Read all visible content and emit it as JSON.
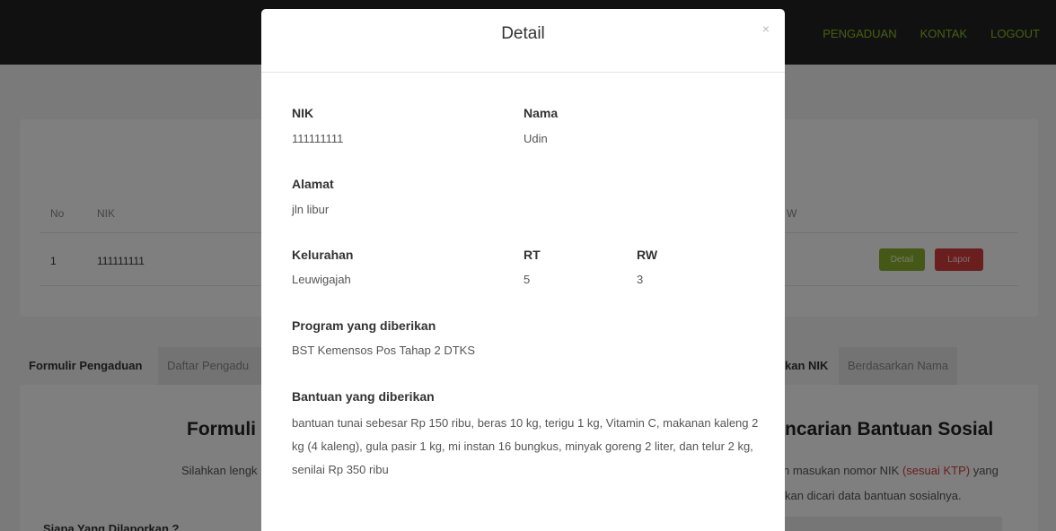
{
  "nav": {
    "links": [
      "PENGADUAN",
      "KONTAK",
      "LOGOUT"
    ]
  },
  "table": {
    "headers": {
      "no": "No",
      "nik": "NIK",
      "rw": "W"
    },
    "rows": [
      {
        "no": "1",
        "nik": "111111111"
      }
    ],
    "detail_label": "Detail",
    "lapor_label": "Lapor"
  },
  "tabs": {
    "left": [
      "Formulir Pengaduan",
      "Daftar Pengadu"
    ],
    "right": [
      "kan NIK",
      "Berdasarkan Nama"
    ]
  },
  "forms": {
    "left_title": "Formuli",
    "left_subtitle": "Silahkan lengk",
    "left_question": "Siapa Yang Dilaporkan ?",
    "right_title": "ncarian Bantuan Sosial",
    "right_line1_pre": "n masukan nomor NIK ",
    "right_line1_red": "(sesuai KTP)",
    "right_line1_post": " yang",
    "right_line2": "kan dicari data bantuan sosialnya."
  },
  "modal": {
    "title": "Detail",
    "close_symbol": "×",
    "nik_label": "NIK",
    "nik_value": "111111111",
    "nama_label": "Nama",
    "nama_value": "Udin",
    "alamat_label": "Alamat",
    "alamat_value": "jln libur",
    "kelurahan_label": "Kelurahan",
    "kelurahan_value": "Leuwigajah",
    "rt_label": "RT",
    "rt_value": "5",
    "rw_label": "RW",
    "rw_value": "3",
    "program_label": "Program yang diberikan",
    "program_value": "BST Kemensos Pos Tahap 2 DTKS",
    "bantuan_label": "Bantuan yang diberikan",
    "bantuan_value": "bantuan tunai sebesar Rp 150 ribu, beras 10 kg, terigu 1 kg, Vitamin C, makanan kaleng 2 kg (4 kaleng), gula pasir 1 kg, mi instan 16 bungkus, minyak goreng 2 liter, dan telur 2 kg, senilai Rp 350 ribu"
  },
  "colors": {
    "accent_green": "#8bb02a",
    "danger_red": "#d63c3c",
    "navbar_bg": "#222222"
  }
}
